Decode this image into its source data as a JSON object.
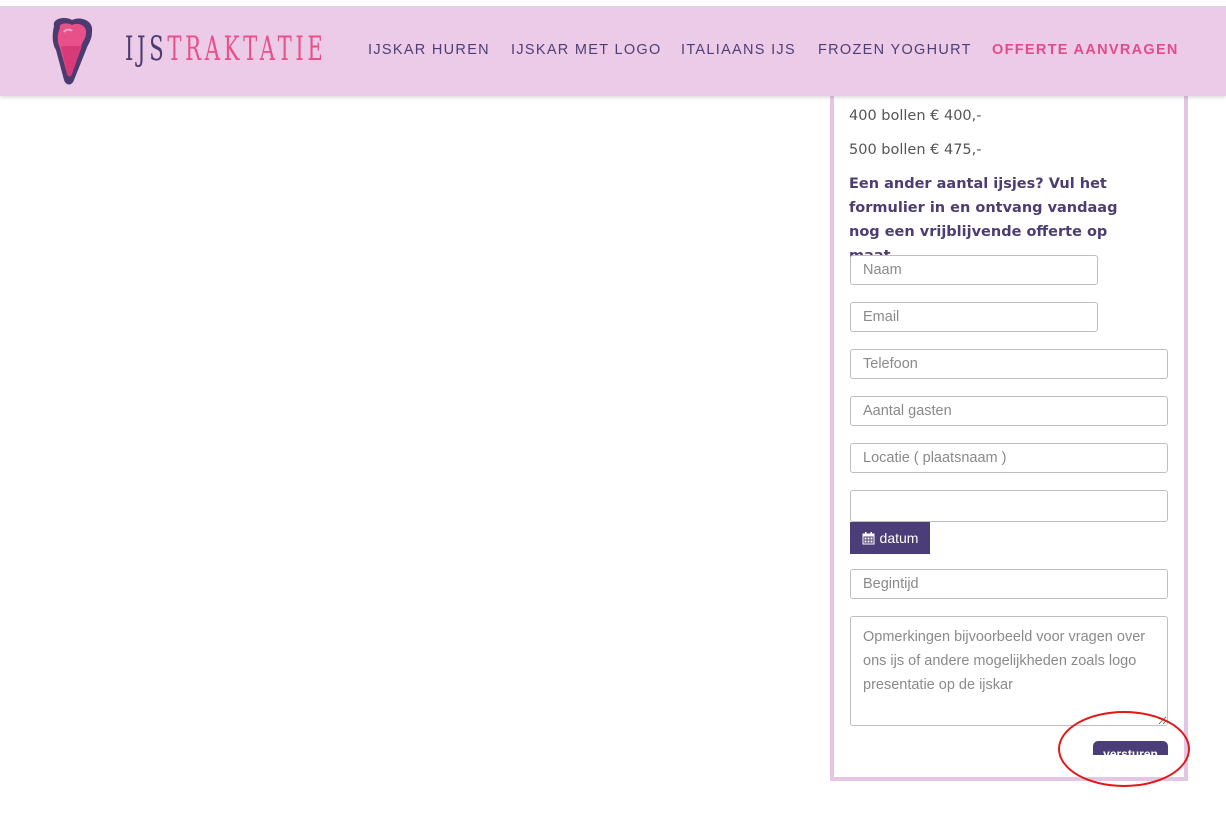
{
  "header": {
    "logo": {
      "part1": "IJS",
      "part2": "TRAKTATIE",
      "icon": "ice-cream-icon"
    },
    "nav": [
      {
        "label": "IJSKAR HUREN"
      },
      {
        "label": "IJSKAR MET LOGO"
      },
      {
        "label": "ITALIAANS IJS"
      },
      {
        "label": "FROZEN YOGHURT"
      },
      {
        "label": "OFFERTE AANVRAGEN",
        "active": true
      }
    ]
  },
  "prices": [
    "400 bollen € 400,-",
    "500 bollen € 475,-"
  ],
  "form": {
    "intro": "Een ander aantal ijsjes? Vul het formulier in en ontvang vandaag nog een vrijblijvende offerte op maat.",
    "naam": "Naam",
    "email": "Email",
    "telefoon": "Telefoon",
    "gasten": "Aantal gasten",
    "locatie": "Locatie ( plaatsnaam )",
    "datum_value": "",
    "datum_button": "datum",
    "datum_icon": "calendar-icon",
    "begintijd": "Begintijd",
    "opmerkingen": "Opmerkingen bijvoorbeeld voor vragen over ons ijs of andere mogelijkheden zoals logo presentatie op de ijskar",
    "submit_label": "versturen"
  },
  "colors": {
    "header_bg": "#eccbe8",
    "brand_purple": "#4b3d78",
    "brand_pink": "#e04d8c",
    "annotation_red": "#e11818"
  }
}
